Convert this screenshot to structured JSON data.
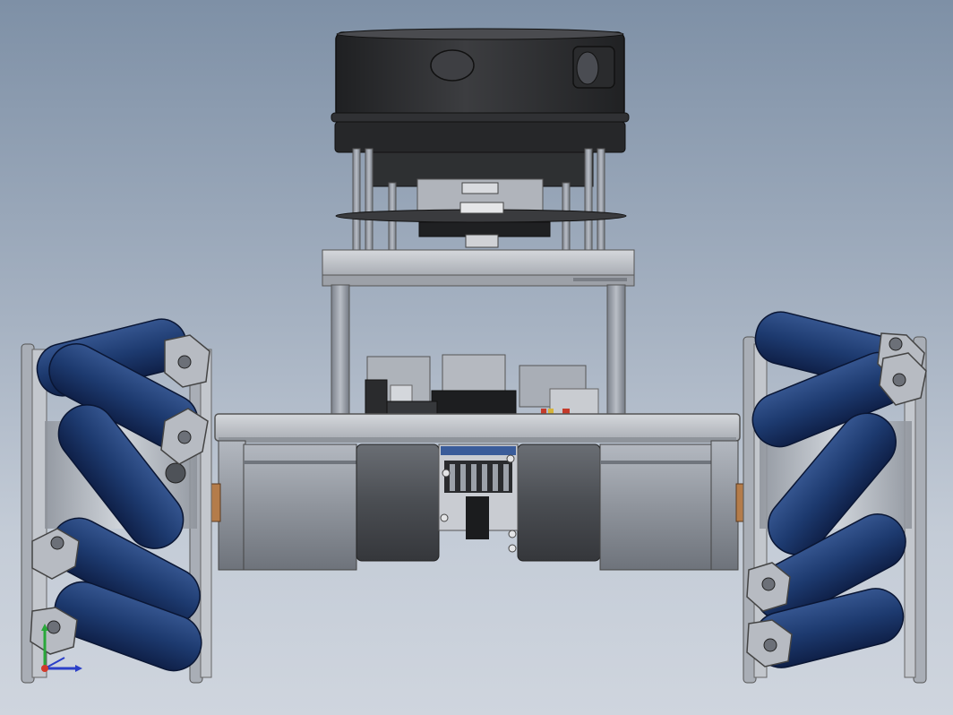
{
  "viewport": {
    "background_top": "#7e90a6",
    "background_bottom": "#cfd5de"
  },
  "model": {
    "components": [
      "lidar-sensor",
      "lidar-mount-standoffs",
      "top-plate",
      "support-posts",
      "controller-board",
      "chassis-plate",
      "drive-motors",
      "gearbox",
      "mecanum-wheel-left",
      "mecanum-wheel-right"
    ],
    "colors": {
      "lidar_body": "#2b2c2e",
      "roller_blue": "#1e3a6e",
      "metal_gray": "#9aa0aa",
      "chassis_plate": "#c3c6cb",
      "motor_body": "#8e939b",
      "wheel_frame": "#b6bbc3"
    }
  },
  "triad": {
    "x_color": "#2b3fc8",
    "y_color": "#29a83a",
    "z_color": "#d23a2a"
  }
}
